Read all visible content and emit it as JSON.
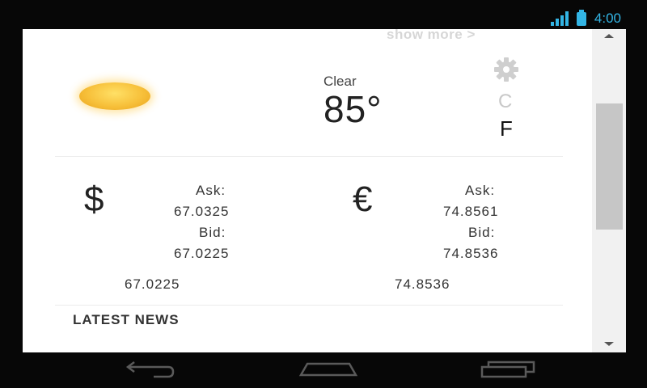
{
  "status_bar": {
    "time": "4:00",
    "accent_color": "#33b5e5",
    "icons": [
      "signal-icon",
      "battery-icon"
    ]
  },
  "weather": {
    "show_more": "show more >",
    "condition": "Clear",
    "temperature": "85°",
    "unit_c": "C",
    "unit_f": "F",
    "icons": [
      "sun-icon",
      "gear-icon"
    ]
  },
  "currencies": [
    {
      "symbol": "$",
      "ask_label": "Ask:",
      "ask": "67.0325",
      "bid_label": "Bid:",
      "bid": "67.0225",
      "rate": "67.0225"
    },
    {
      "symbol": "€",
      "ask_label": "Ask:",
      "ask": "74.8561",
      "bid_label": "Bid:",
      "bid": "74.8536",
      "rate": "74.8536"
    }
  ],
  "news": {
    "title": "LATEST NEWS"
  },
  "nav_bar": {
    "icons": [
      "back-icon",
      "home-icon",
      "recent-apps-icon"
    ]
  }
}
